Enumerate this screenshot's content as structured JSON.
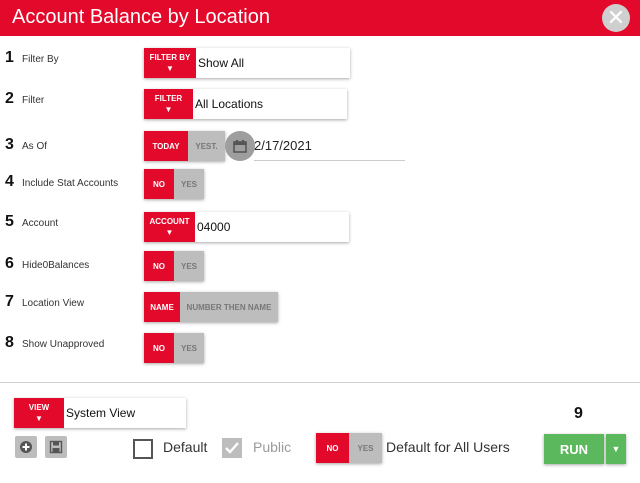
{
  "window": {
    "title": "Account Balance by Location",
    "close_glyph": "✕"
  },
  "fields": [
    {
      "num": "1",
      "label": "Filter By",
      "button": "FILTER BY",
      "value": "Show All"
    },
    {
      "num": "2",
      "label": "Filter",
      "button": "FILTER",
      "value": "All Locations"
    },
    {
      "num": "3",
      "label": "As Of",
      "on": "TODAY",
      "off": "YEST.",
      "value": "2/17/2021"
    },
    {
      "num": "4",
      "label": "Include Stat Accounts",
      "on": "NO",
      "off": "YES"
    },
    {
      "num": "5",
      "label": "Account",
      "button": "ACCOUNT",
      "value": "04000"
    },
    {
      "num": "6",
      "label": "Hide0Balances",
      "on": "NO",
      "off": "YES"
    },
    {
      "num": "7",
      "label": "Location View",
      "on": "NAME",
      "off": "NUMBER THEN NAME"
    },
    {
      "num": "8",
      "label": "Show Unapproved",
      "on": "NO",
      "off": "YES"
    }
  ],
  "footer": {
    "view_button": "VIEW",
    "view_value": "System View",
    "default_label": "Default",
    "default_checked": false,
    "public_label": "Public",
    "public_checked": true,
    "all_users_on": "NO",
    "all_users_off": "YES",
    "all_users_label": "Default for All Users",
    "step_num": "9",
    "run_label": "RUN",
    "add_icon": "plus-circle-icon",
    "save_icon": "floppy-disk-icon"
  },
  "colors": {
    "accent": "#e3092b",
    "run": "#5cb85c",
    "inactive": "#bdbdbd"
  }
}
